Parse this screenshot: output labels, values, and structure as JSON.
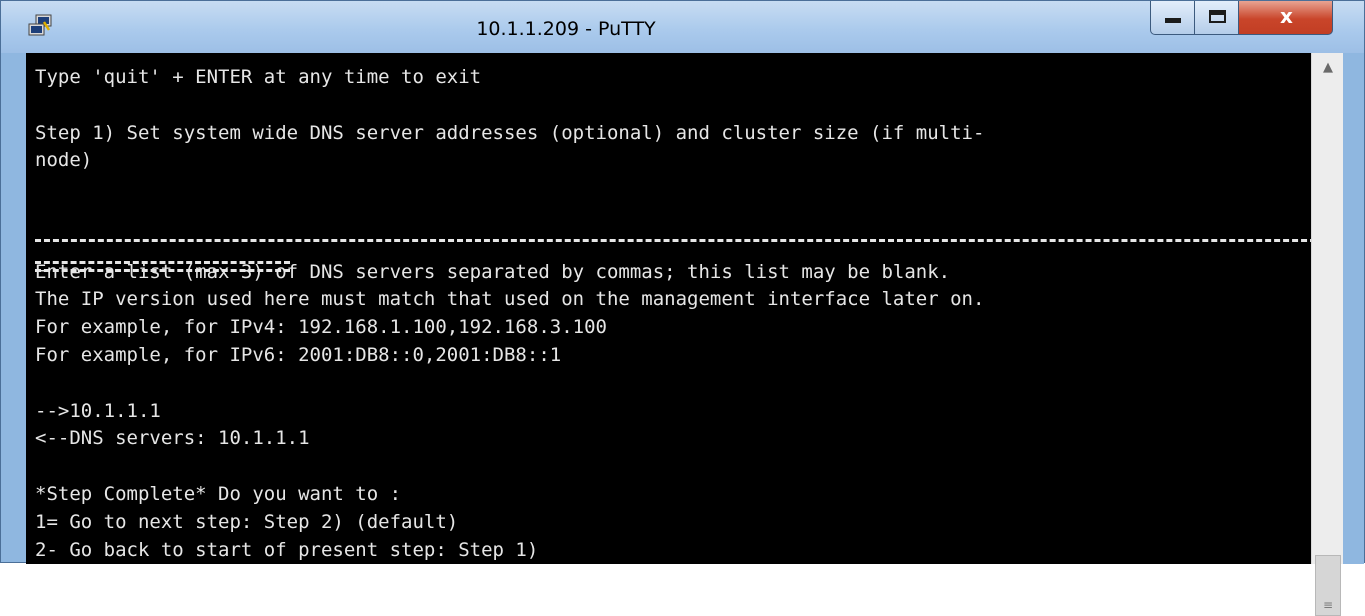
{
  "window": {
    "title": "10.1.1.209 - PuTTY",
    "app_icon": "putty-icon",
    "controls": {
      "minimize_icon": "minimize-icon",
      "maximize_icon": "maximize-icon",
      "close_label": "x"
    }
  },
  "terminal": {
    "lines": [
      "Type 'quit' + ENTER at any time to exit",
      "",
      "Step 1) Set system wide DNS server addresses (optional) and cluster size (if multi-",
      "node)",
      "",
      "",
      "",
      "Enter a list (max 3) of DNS servers separated by commas; this list may be blank.",
      "The IP version used here must match that used on the management interface later on.",
      "For example, for IPv4: 192.168.1.100,192.168.3.100",
      "For example, for IPv6: 2001:DB8::0,2001:DB8::1",
      "",
      "-->10.1.1.1",
      "<--DNS servers: 10.1.1.1",
      "",
      "*Step Complete* Do you want to :",
      "1= Go to next step: Step 2) (default)",
      "2- Go back to start of present step: Step 1)"
    ],
    "separator_dash_icon": "dashed-rule",
    "separator_equals_icon": "double-dashed-rule"
  },
  "scrollbar": {
    "up_arrow_icon": "chevron-up-icon",
    "grip_icon": "grip-icon"
  },
  "colors": {
    "terminal_bg": "#000000",
    "terminal_fg": "#e6e6e6",
    "frame": "#8fb7e0",
    "close_button": "#c9452a"
  }
}
